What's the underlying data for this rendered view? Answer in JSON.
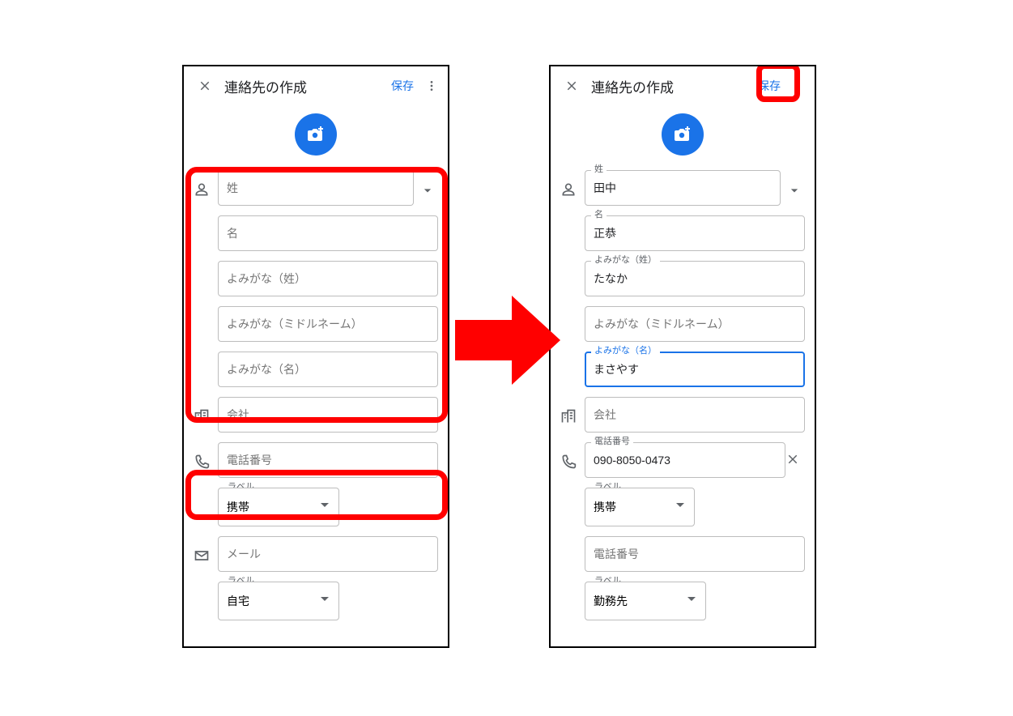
{
  "left": {
    "header": {
      "title": "連絡先の作成",
      "save": "保存"
    },
    "name": {
      "lastname_ph": "姓",
      "firstname_ph": "名",
      "phonetic_last_ph": "よみがな（姓）",
      "phonetic_middle_ph": "よみがな（ミドルネーム）",
      "phonetic_first_ph": "よみがな（名）"
    },
    "company": {
      "ph": "会社"
    },
    "phone": {
      "number_ph": "電話番号",
      "label_label": "ラベル",
      "label_value": "携帯"
    },
    "email": {
      "ph": "メール",
      "label_label": "ラベル",
      "label_value": "自宅"
    }
  },
  "right": {
    "header": {
      "title": "連絡先の作成",
      "save": "保存"
    },
    "name": {
      "lastname_label": "姓",
      "lastname_value": "田中",
      "firstname_label": "名",
      "firstname_value": "正恭",
      "phonetic_last_label": "よみがな（姓）",
      "phonetic_last_value": "たなか",
      "phonetic_middle_ph": "よみがな（ミドルネーム）",
      "phonetic_first_label": "よみがな（名）",
      "phonetic_first_value": "まさやす"
    },
    "company": {
      "ph": "会社"
    },
    "phone1": {
      "number_label": "電話番号",
      "number_value": "090-8050-0473",
      "label_label": "ラベル",
      "label_value": "携帯"
    },
    "phone2": {
      "number_ph": "電話番号",
      "label_label": "ラベル",
      "label_value": "勤務先"
    }
  }
}
